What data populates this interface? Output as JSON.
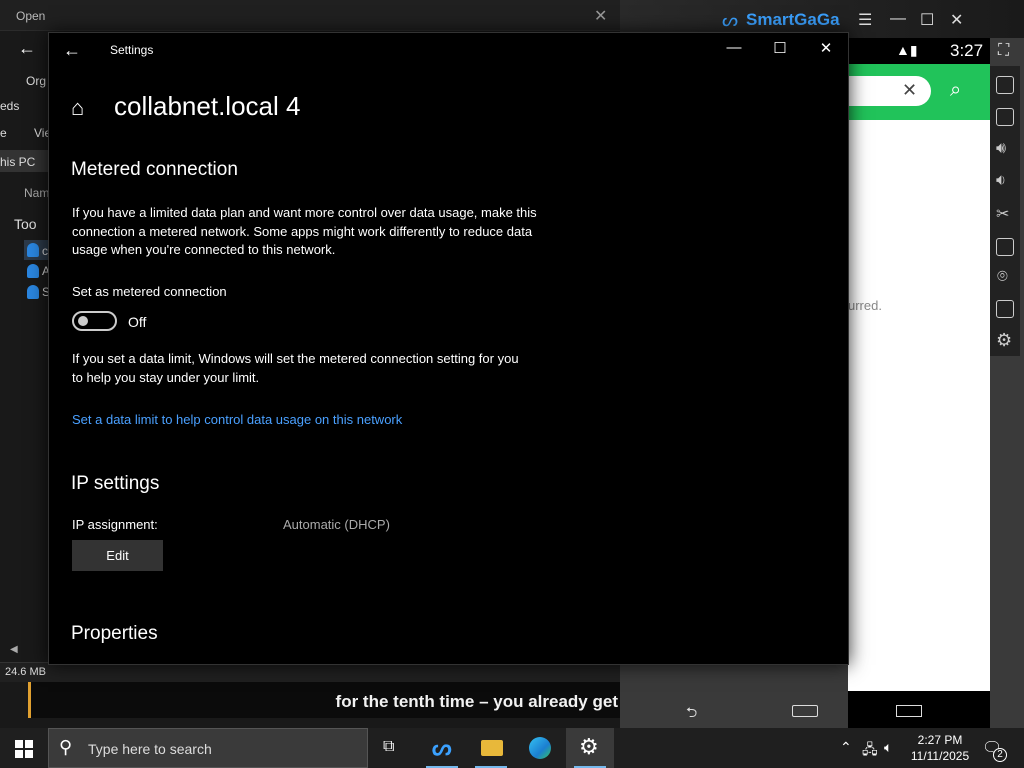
{
  "explorer": {
    "title": "Open",
    "organize": "Org",
    "downloads_fragment": "eds",
    "home_fragment": "e",
    "view_fragment": "Vie",
    "thispc": "his PC",
    "name_header": "Nam",
    "tools_fragment": "Too",
    "status_size": "24.6 MB",
    "file_items": [
      "c",
      "A",
      "S"
    ]
  },
  "subtitle": "for the tenth time – you already get",
  "emulator": {
    "brand": "SmartGaGa",
    "clock": "3:27",
    "occurred_fragment": "urred."
  },
  "settings": {
    "window_title": "Settings",
    "page_title": "collabnet.local 4",
    "metered": {
      "heading": "Metered connection",
      "description": "If you have a limited data plan and want more control over data usage, make this connection a metered network. Some apps might work differently to reduce data usage when you're connected to this network.",
      "toggle_label": "Set as metered connection",
      "toggle_state": "Off",
      "data_limit_text": "If you set a data limit, Windows will set the metered connection setting for you to help you stay under your limit.",
      "data_limit_link": "Set a data limit to help control data usage on this network"
    },
    "ip": {
      "heading": "IP settings",
      "assignment_label": "IP assignment:",
      "assignment_value": "Automatic (DHCP)",
      "edit_button": "Edit"
    },
    "properties_heading": "Properties"
  },
  "taskbar": {
    "search_placeholder": "Type here to search",
    "time": "2:27 PM",
    "date": "11/11/2025",
    "notification_count": "2"
  },
  "colors": {
    "accent_link": "#4aa0ff",
    "emulator_green": "#21c35a",
    "brand_blue": "#3ba1ff"
  }
}
